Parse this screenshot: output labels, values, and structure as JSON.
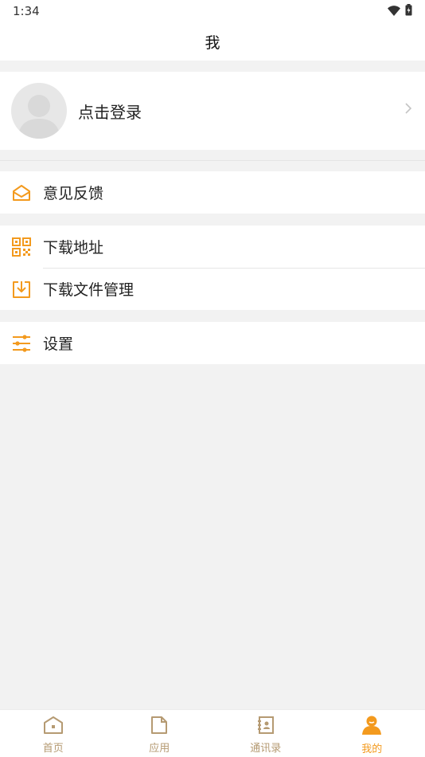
{
  "status_bar": {
    "time": "1:34"
  },
  "header": {
    "title": "我"
  },
  "profile": {
    "login_label": "点击登录"
  },
  "menu": {
    "group1": [
      {
        "label": "意见反馈",
        "icon": "feedback-mail-icon"
      }
    ],
    "group2": [
      {
        "label": "下载地址",
        "icon": "qr-code-icon"
      },
      {
        "label": "下载文件管理",
        "icon": "download-file-icon"
      }
    ],
    "group3": [
      {
        "label": "设置",
        "icon": "settings-sliders-icon"
      }
    ]
  },
  "bottom_nav": [
    {
      "label": "首页",
      "icon": "home-icon",
      "active": false
    },
    {
      "label": "应用",
      "icon": "document-icon",
      "active": false
    },
    {
      "label": "通讯录",
      "icon": "contacts-book-icon",
      "active": false
    },
    {
      "label": "我的",
      "icon": "person-icon",
      "active": true
    }
  ],
  "colors": {
    "accent": "#f39a1e",
    "nav_inactive": "#b59a72",
    "background": "#f2f2f2"
  }
}
